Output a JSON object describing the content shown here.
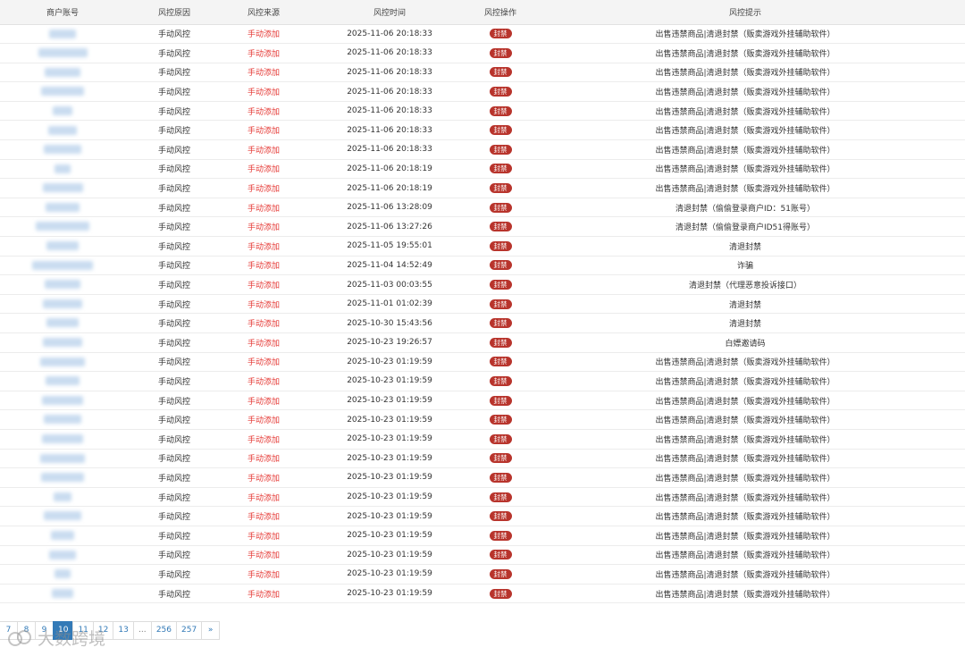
{
  "headers": [
    "商户账号",
    "风控原因",
    "风控来源",
    "风控时间",
    "风控操作",
    "风控提示"
  ],
  "badge_color": "#b8342c",
  "source_color": "#e53935",
  "rows": [
    {
      "reason": "手动风控",
      "source": "手动添加",
      "time": "2025-11-06 20:18:33",
      "action": "封禁",
      "tip": "出售违禁商品|清退封禁（贩卖游戏外挂辅助软件）"
    },
    {
      "reason": "手动风控",
      "source": "手动添加",
      "time": "2025-11-06 20:18:33",
      "action": "封禁",
      "tip": "出售违禁商品|清退封禁（贩卖游戏外挂辅助软件）"
    },
    {
      "reason": "手动风控",
      "source": "手动添加",
      "time": "2025-11-06 20:18:33",
      "action": "封禁",
      "tip": "出售违禁商品|清退封禁（贩卖游戏外挂辅助软件）"
    },
    {
      "reason": "手动风控",
      "source": "手动添加",
      "time": "2025-11-06 20:18:33",
      "action": "封禁",
      "tip": "出售违禁商品|清退封禁（贩卖游戏外挂辅助软件）"
    },
    {
      "reason": "手动风控",
      "source": "手动添加",
      "time": "2025-11-06 20:18:33",
      "action": "封禁",
      "tip": "出售违禁商品|清退封禁（贩卖游戏外挂辅助软件）"
    },
    {
      "reason": "手动风控",
      "source": "手动添加",
      "time": "2025-11-06 20:18:33",
      "action": "封禁",
      "tip": "出售违禁商品|清退封禁（贩卖游戏外挂辅助软件）"
    },
    {
      "reason": "手动风控",
      "source": "手动添加",
      "time": "2025-11-06 20:18:33",
      "action": "封禁",
      "tip": "出售违禁商品|清退封禁（贩卖游戏外挂辅助软件）"
    },
    {
      "reason": "手动风控",
      "source": "手动添加",
      "time": "2025-11-06 20:18:19",
      "action": "封禁",
      "tip": "出售违禁商品|清退封禁（贩卖游戏外挂辅助软件）"
    },
    {
      "reason": "手动风控",
      "source": "手动添加",
      "time": "2025-11-06 20:18:19",
      "action": "封禁",
      "tip": "出售违禁商品|清退封禁（贩卖游戏外挂辅助软件）"
    },
    {
      "reason": "手动风控",
      "source": "手动添加",
      "time": "2025-11-06 13:28:09",
      "action": "封禁",
      "tip": "清退封禁（偷偷登录商户ID：51账号）"
    },
    {
      "reason": "手动风控",
      "source": "手动添加",
      "time": "2025-11-06 13:27:26",
      "action": "封禁",
      "tip": "清退封禁（偷偷登录商户ID51得账号）"
    },
    {
      "reason": "手动风控",
      "source": "手动添加",
      "time": "2025-11-05 19:55:01",
      "action": "封禁",
      "tip": "清退封禁"
    },
    {
      "reason": "手动风控",
      "source": "手动添加",
      "time": "2025-11-04 14:52:49",
      "action": "封禁",
      "tip": "诈骗"
    },
    {
      "reason": "手动风控",
      "source": "手动添加",
      "time": "2025-11-03 00:03:55",
      "action": "封禁",
      "tip": "清退封禁（代理恶意投诉接口）"
    },
    {
      "reason": "手动风控",
      "source": "手动添加",
      "time": "2025-11-01 01:02:39",
      "action": "封禁",
      "tip": "清退封禁"
    },
    {
      "reason": "手动风控",
      "source": "手动添加",
      "time": "2025-10-30 15:43:56",
      "action": "封禁",
      "tip": "清退封禁"
    },
    {
      "reason": "手动风控",
      "source": "手动添加",
      "time": "2025-10-23 19:26:57",
      "action": "封禁",
      "tip": "白嫖邀请码"
    },
    {
      "reason": "手动风控",
      "source": "手动添加",
      "time": "2025-10-23 01:19:59",
      "action": "封禁",
      "tip": "出售违禁商品|清退封禁（贩卖游戏外挂辅助软件）"
    },
    {
      "reason": "手动风控",
      "source": "手动添加",
      "time": "2025-10-23 01:19:59",
      "action": "封禁",
      "tip": "出售违禁商品|清退封禁（贩卖游戏外挂辅助软件）"
    },
    {
      "reason": "手动风控",
      "source": "手动添加",
      "time": "2025-10-23 01:19:59",
      "action": "封禁",
      "tip": "出售违禁商品|清退封禁（贩卖游戏外挂辅助软件）"
    },
    {
      "reason": "手动风控",
      "source": "手动添加",
      "time": "2025-10-23 01:19:59",
      "action": "封禁",
      "tip": "出售违禁商品|清退封禁（贩卖游戏外挂辅助软件）"
    },
    {
      "reason": "手动风控",
      "source": "手动添加",
      "time": "2025-10-23 01:19:59",
      "action": "封禁",
      "tip": "出售违禁商品|清退封禁（贩卖游戏外挂辅助软件）"
    },
    {
      "reason": "手动风控",
      "source": "手动添加",
      "time": "2025-10-23 01:19:59",
      "action": "封禁",
      "tip": "出售违禁商品|清退封禁（贩卖游戏外挂辅助软件）"
    },
    {
      "reason": "手动风控",
      "source": "手动添加",
      "time": "2025-10-23 01:19:59",
      "action": "封禁",
      "tip": "出售违禁商品|清退封禁（贩卖游戏外挂辅助软件）"
    },
    {
      "reason": "手动风控",
      "source": "手动添加",
      "time": "2025-10-23 01:19:59",
      "action": "封禁",
      "tip": "出售违禁商品|清退封禁（贩卖游戏外挂辅助软件）"
    },
    {
      "reason": "手动风控",
      "source": "手动添加",
      "time": "2025-10-23 01:19:59",
      "action": "封禁",
      "tip": "出售违禁商品|清退封禁（贩卖游戏外挂辅助软件）"
    },
    {
      "reason": "手动风控",
      "source": "手动添加",
      "time": "2025-10-23 01:19:59",
      "action": "封禁",
      "tip": "出售违禁商品|清退封禁（贩卖游戏外挂辅助软件）"
    },
    {
      "reason": "手动风控",
      "source": "手动添加",
      "time": "2025-10-23 01:19:59",
      "action": "封禁",
      "tip": "出售违禁商品|清退封禁（贩卖游戏外挂辅助软件）"
    },
    {
      "reason": "手动风控",
      "source": "手动添加",
      "time": "2025-10-23 01:19:59",
      "action": "封禁",
      "tip": "出售违禁商品|清退封禁（贩卖游戏外挂辅助软件）"
    },
    {
      "reason": "手动风控",
      "source": "手动添加",
      "time": "2025-10-23 01:19:59",
      "action": "封禁",
      "tip": "出售违禁商品|清退封禁（贩卖游戏外挂辅助软件）"
    }
  ],
  "pagination": {
    "pages": [
      "7",
      "8",
      "9",
      "10",
      "11",
      "12",
      "13",
      "...",
      "256",
      "257",
      "»"
    ],
    "active": "10"
  },
  "watermark": "大数跨境"
}
